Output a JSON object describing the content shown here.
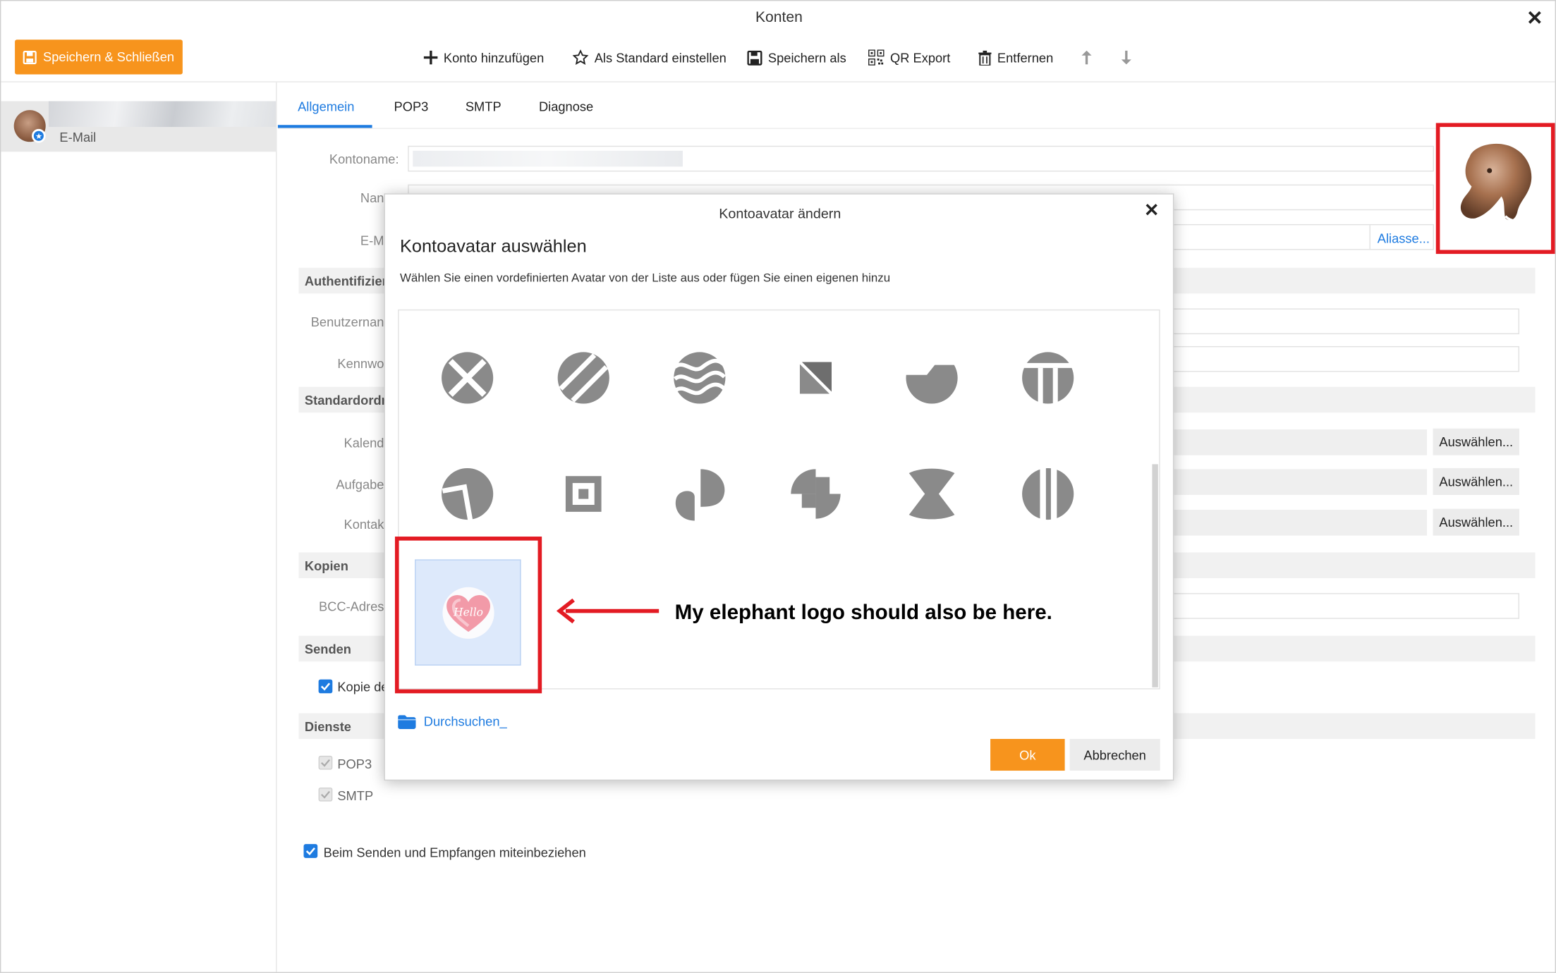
{
  "window": {
    "title": "Konten",
    "close_glyph": "✕"
  },
  "toolbar": {
    "save_close": "Speichern & Schließen",
    "add_account": "Konto hinzufügen",
    "set_default": "Als Standard einstellen",
    "save_as": "Speichern als",
    "qr_export": "QR Export",
    "remove": "Entfernen",
    "icons": [
      "save-icon",
      "plus-icon",
      "star-icon",
      "floppy-icon",
      "qr-code-icon",
      "trash-icon",
      "arrow-up-icon",
      "arrow-down-icon"
    ]
  },
  "sidebar": {
    "account_label": "E-Mail"
  },
  "tabs": [
    "Allgemein",
    "POP3",
    "SMTP",
    "Diagnose"
  ],
  "form": {
    "account_name_label": "Kontoname:",
    "name_label": "Nan",
    "email_label": "E-M",
    "aliases_link": "Aliasse...",
    "section_auth": "Authentifizier",
    "username_label": "Benutzernan",
    "password_label": "Kennwo",
    "section_default_folders": "Standardordn",
    "calendar_label": "Kalend",
    "tasks_label": "Aufgabe",
    "contacts_label": "Kontak",
    "choose_button": "Auswählen...",
    "section_copies": "Kopien",
    "bcc_label": "BCC-Adres",
    "section_send": "Senden",
    "copy_checkbox": "Kopie de",
    "section_services": "Dienste",
    "pop3": "POP3",
    "smtp": "SMTP",
    "include_checkbox": "Beim Senden und Empfangen miteinbeziehen"
  },
  "dialog": {
    "title": "Kontoavatar ändern",
    "heading": "Kontoavatar auswählen",
    "subtitle": "Wählen Sie einen vordefinierten Avatar von der Liste aus oder fügen Sie einen eigenen hinzu",
    "browse": "Durchsuchen_",
    "ok": "Ok",
    "cancel": "Abbrechen",
    "custom_avatar_text": "Hello",
    "annotation": "My elephant logo should also be here.",
    "avatar_icons": [
      "circle-x-icon",
      "circle-slashes-icon",
      "circle-waves-icon",
      "square-triangle-icon",
      "circle-notch-icon",
      "circle-t-icon",
      "circle-split-icon",
      "square-target-icon",
      "petal-icon",
      "puzzle-shape-icon",
      "hourglass-icon",
      "circle-bars-icon"
    ]
  },
  "colors": {
    "accent": "#f7941d",
    "link": "#1e7be0",
    "annotation": "#e31b23",
    "avatar_grey": "#8a8a8a"
  }
}
